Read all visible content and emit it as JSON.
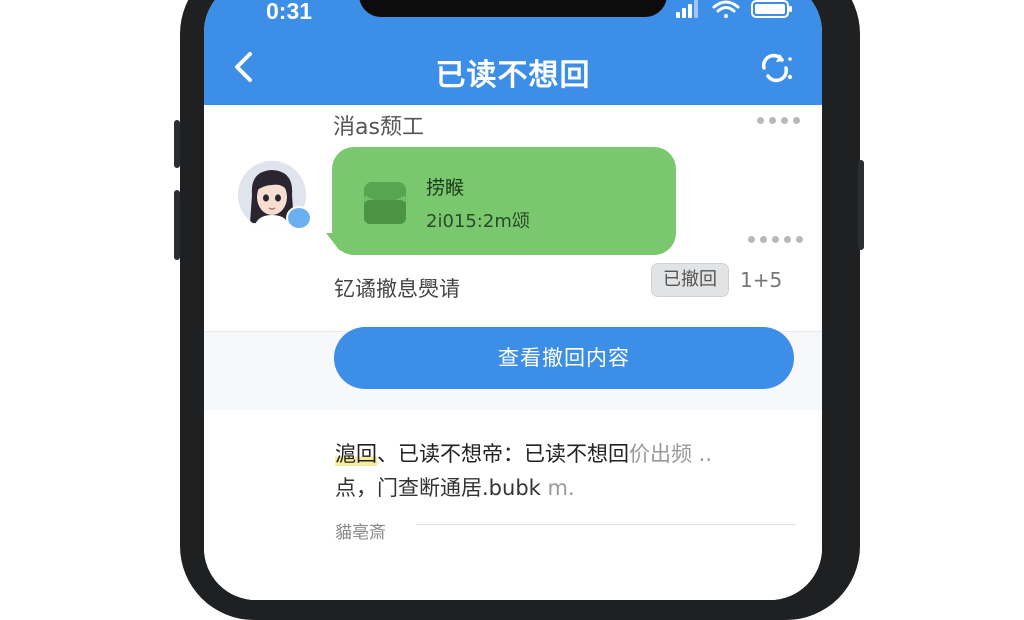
{
  "status_bar": {
    "time": "0:31"
  },
  "nav": {
    "title": "已读不想回",
    "back_icon": "chevron-left-icon",
    "settings_icon": "refresh-settings-icon"
  },
  "message": {
    "sender_label": "消as颓工",
    "card_title": "捞睺",
    "card_time": "2i015:2m颂",
    "recall_text": "钇谲撤息爂请",
    "recalled_badge": "已撤回",
    "count": "1+5"
  },
  "action": {
    "view_recalled_label": "查看撤回内容"
  },
  "article": {
    "line1_highlight": "滬回",
    "line1_main": "、已读不想帝：已读不想回",
    "line1_tail": "价出频 ..",
    "line2_main": "点，门查断通居.bubk",
    "line2_tail": " m.",
    "footer_label": "貓亳斎"
  },
  "colors": {
    "header_blue": "#3d8ee6",
    "bubble_green": "#7ac86d",
    "highlight": "#f6ec9a"
  }
}
